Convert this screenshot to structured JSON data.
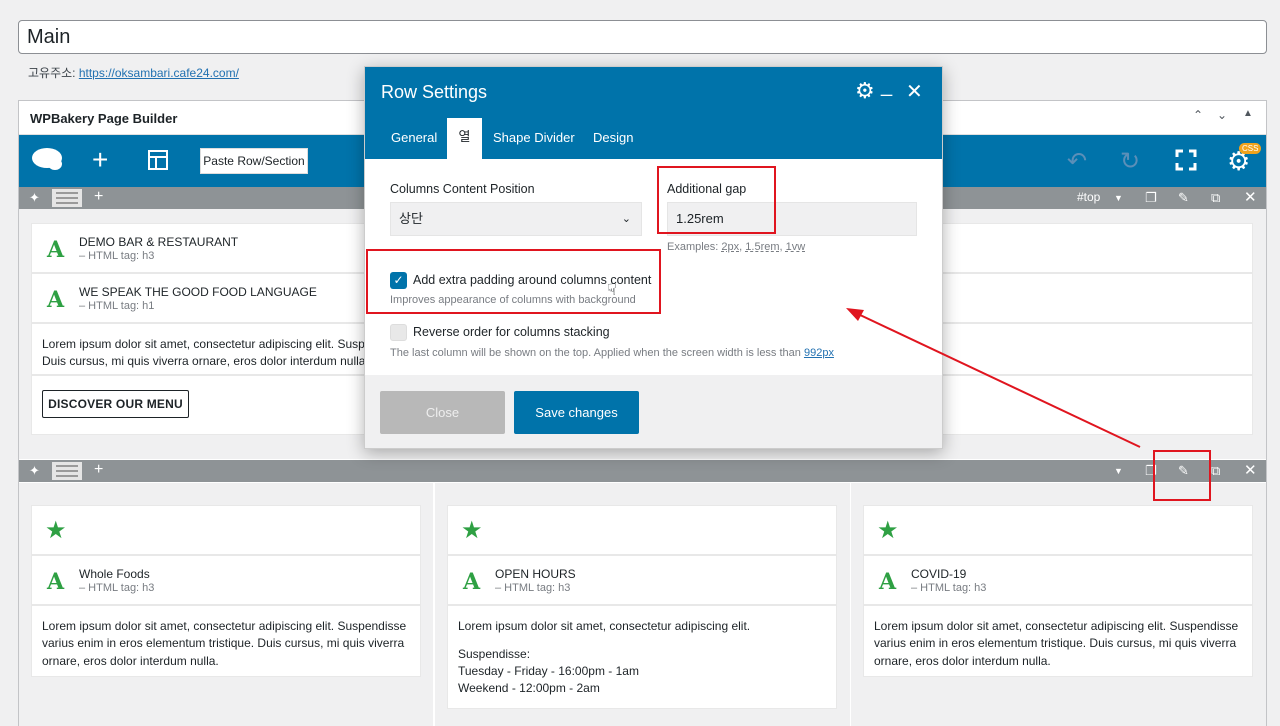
{
  "post": {
    "title": "Main",
    "permalink_label": "고유주소:",
    "permalink_url": "https://oksambari.cafe24.com/"
  },
  "builder": {
    "title": "WPBakery Page Builder",
    "header_controls": [
      "chevron-up-icon",
      "chevron-down-icon",
      "triangle-up-icon"
    ],
    "paste_label": "Paste Row/Section",
    "css_badge": "CSS"
  },
  "row1": {
    "anchor": "#top",
    "elements": [
      {
        "title": "DEMO BAR & RESTAURANT",
        "sub": "– HTML tag: h3"
      },
      {
        "title": "WE SPEAK THE GOOD FOOD LANGUAGE",
        "sub": "– HTML tag: h1"
      }
    ],
    "text_line1": "Lorem ipsum dolor sit amet, consectetur adipiscing elit. Suspen",
    "text_line2": "Duis cursus, mi quis viverra ornare, eros dolor interdum nulla.",
    "button": "DISCOVER OUR MENU"
  },
  "row2": {
    "columns": [
      {
        "title": "Whole Foods",
        "sub": "– HTML tag: h3",
        "text": [
          "Lorem ipsum dolor sit amet, consectetur adipiscing elit. Suspendisse",
          "varius enim in eros elementum tristique. Duis cursus, mi quis viverra",
          "ornare, eros dolor interdum nulla."
        ]
      },
      {
        "title": "OPEN HOURS",
        "sub": "– HTML tag: h3",
        "text": [
          "Lorem ipsum dolor sit amet, consectetur adipiscing elit.",
          "Suspendisse:",
          "Tuesday - Friday - 16:00pm - 1am",
          "Weekend - 12:00pm - 2am"
        ]
      },
      {
        "title": "COVID-19",
        "sub": "– HTML tag: h3",
        "text": [
          "Lorem ipsum dolor sit amet, consectetur adipiscing elit. Suspendisse",
          "varius enim in eros elementum tristique. Duis cursus, mi quis viverra",
          "ornare, eros dolor interdum nulla."
        ]
      }
    ]
  },
  "modal": {
    "title": "Row Settings",
    "tabs": [
      "General",
      "열",
      "Shape Divider",
      "Design"
    ],
    "active_tab": "열",
    "columns_position_label": "Columns Content Position",
    "columns_position_value": "상단",
    "gap_label": "Additional gap",
    "gap_value": "1.25rem",
    "gap_examples_prefix": "Examples:",
    "gap_examples": [
      "2px",
      "1.5rem",
      "1vw"
    ],
    "extra_padding_label": "Add extra padding around columns content",
    "extra_padding_checked": true,
    "extra_padding_help": "Improves appearance of columns with background",
    "reverse_label": "Reverse order for columns stacking",
    "reverse_checked": false,
    "reverse_help": "The last column will be shown on the top. Applied when the screen width is less than",
    "reverse_help_link": "992px",
    "close_label": "Close",
    "save_label": "Save changes"
  },
  "colors": {
    "accent": "#0073aa",
    "annotation": "#e0151f",
    "element_icon": "#2ea043"
  }
}
